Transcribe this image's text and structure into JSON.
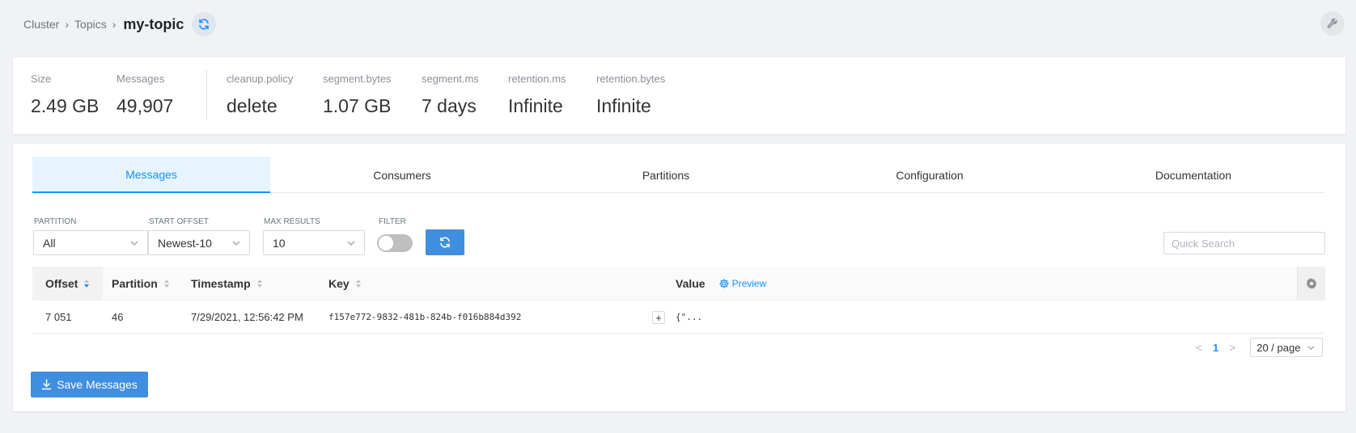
{
  "breadcrumb": {
    "items": [
      "Cluster",
      "Topics"
    ],
    "current": "my-topic"
  },
  "icons": {
    "refresh": "refresh-icon",
    "wrench": "wrench-icon",
    "settings": "gear-icon",
    "download": "download-icon"
  },
  "stats": [
    {
      "label": "Size",
      "value": "2.49 GB"
    },
    {
      "label": "Messages",
      "value": "49,907"
    },
    {
      "label": "cleanup.policy",
      "value": "delete"
    },
    {
      "label": "segment.bytes",
      "value": "1.07 GB"
    },
    {
      "label": "segment.ms",
      "value": "7 days"
    },
    {
      "label": "retention.ms",
      "value": "Infinite"
    },
    {
      "label": "retention.bytes",
      "value": "Infinite"
    }
  ],
  "tabs": [
    {
      "label": "Messages",
      "active": true
    },
    {
      "label": "Consumers",
      "active": false
    },
    {
      "label": "Partitions",
      "active": false
    },
    {
      "label": "Configuration",
      "active": false
    },
    {
      "label": "Documentation",
      "active": false
    }
  ],
  "filters": {
    "partition": {
      "label": "PARTITION",
      "value": "All"
    },
    "start_offset": {
      "label": "START OFFSET",
      "value": "Newest-10"
    },
    "max_results": {
      "label": "MAX RESULTS",
      "value": "10"
    },
    "filter": {
      "label": "FILTER",
      "enabled": false
    },
    "quick_search_placeholder": "Quick Search"
  },
  "table": {
    "columns": {
      "offset": "Offset",
      "partition": "Partition",
      "timestamp": "Timestamp",
      "key": "Key",
      "value": "Value",
      "preview": "Preview"
    },
    "rows": [
      {
        "offset": "7 051",
        "partition": "46",
        "timestamp": "7/29/2021, 12:56:42 PM",
        "key": "f157e772-9832-481b-824b-f016b884d392",
        "expand": "+",
        "value": "{\"..."
      }
    ]
  },
  "pagination": {
    "prev": "<",
    "current_page": "1",
    "next": ">",
    "page_size": "20 / page"
  },
  "save_button": {
    "label": "Save Messages"
  },
  "colors": {
    "accent": "#1890ff",
    "button": "#3f8ee0",
    "background": "#f0f2f5"
  }
}
